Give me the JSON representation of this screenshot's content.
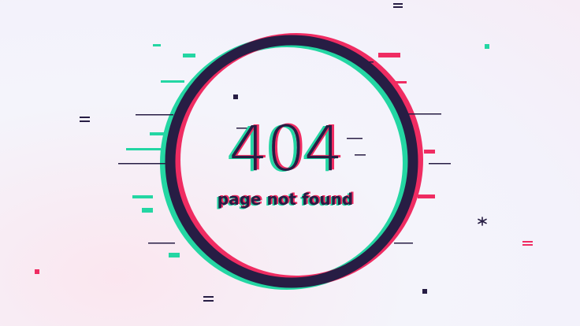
{
  "error": {
    "code": "404",
    "message": "page not found"
  },
  "colors": {
    "ink": "#271d44",
    "teal": "#24d6a3",
    "pink": "#ef2c62",
    "background": "#f4f4fb"
  },
  "icons": {
    "ring": "glitch-ring-icon",
    "sparkle": "asterisk-sparkle-icon"
  }
}
